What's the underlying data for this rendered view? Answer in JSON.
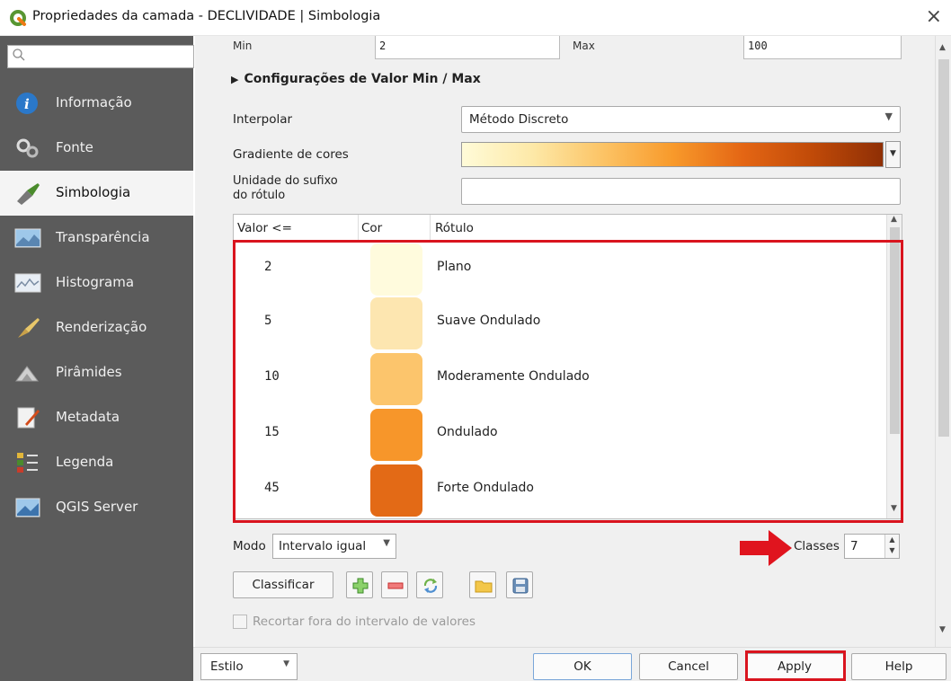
{
  "window": {
    "title": "Propriedades da camada - DECLIVIDADE | Simbologia",
    "close": "×"
  },
  "sidebar": {
    "search_icon": "search-icon",
    "items": [
      {
        "label": "Informação",
        "icon": "info-icon"
      },
      {
        "label": "Fonte",
        "icon": "source-icon"
      },
      {
        "label": "Simbologia",
        "icon": "symbology-icon",
        "active": true
      },
      {
        "label": "Transparência",
        "icon": "transparency-icon"
      },
      {
        "label": "Histograma",
        "icon": "histogram-icon"
      },
      {
        "label": "Renderização",
        "icon": "rendering-icon"
      },
      {
        "label": "Pirâmides",
        "icon": "pyramids-icon"
      },
      {
        "label": "Metadata",
        "icon": "metadata-icon"
      },
      {
        "label": "Legenda",
        "icon": "legend-icon"
      },
      {
        "label": "QGIS Server",
        "icon": "qgis-server-icon"
      }
    ]
  },
  "minmax": {
    "min_label": "Min",
    "min_value": "2",
    "max_label": "Max",
    "max_value": "100"
  },
  "section": {
    "title": "Configurações de Valor Min / Max"
  },
  "interpolar": {
    "label": "Interpolar",
    "value": "Método Discreto"
  },
  "gradiente": {
    "label": "Gradiente de cores"
  },
  "sufixo": {
    "label_line1": "Unidade do sufixo",
    "label_line2": "do rótulo",
    "value": ""
  },
  "table": {
    "headers": [
      "Valor <=",
      "Cor",
      "Rótulo"
    ],
    "rows": [
      {
        "value": "2",
        "color": "#fffbdd",
        "label": "Plano"
      },
      {
        "value": "5",
        "color": "#fde6b0",
        "label": "Suave Ondulado"
      },
      {
        "value": "10",
        "color": "#fcc56c",
        "label": "Moderamente Ondulado"
      },
      {
        "value": "15",
        "color": "#f7962a",
        "label": "Ondulado"
      },
      {
        "value": "45",
        "color": "#e36a16",
        "label": "Forte Ondulado"
      },
      {
        "value": "",
        "color": "#c44d0b",
        "label": ""
      }
    ]
  },
  "mode": {
    "label": "Modo",
    "value": "Intervalo igual"
  },
  "classes": {
    "label": "Classes",
    "value": "7"
  },
  "toolbar": {
    "classify_label": "Classificar"
  },
  "clip": {
    "label": "Recortar fora do intervalo de valores"
  },
  "footer": {
    "style_label": "Estilo",
    "ok_label": "OK",
    "cancel_label": "Cancel",
    "apply_label": "Apply",
    "help_label": "Help"
  },
  "colors": {
    "highlight_red": "#d9141e",
    "sidebar_bg": "#5b5b5b",
    "qgis_green": "#589632"
  }
}
